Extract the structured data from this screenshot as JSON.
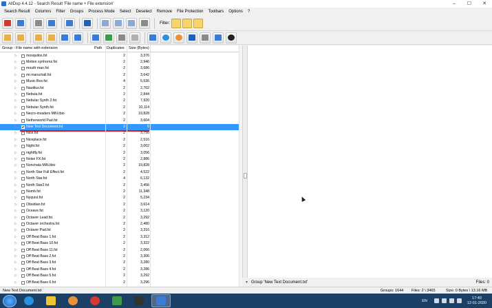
{
  "window": {
    "title": "AllDup 4.4.12 - Search Result 'File name + File extension'",
    "minimize": "–",
    "maximize": "☐",
    "close": "✕"
  },
  "menu": [
    "Search Result",
    "Columns",
    "Filter",
    "Groups",
    "Process Mode",
    "Select",
    "Deselect",
    "Remove",
    "File Protection",
    "Toolbars",
    "Options",
    "?"
  ],
  "toolbar": {
    "filter_label": "Filter:",
    "colors": {
      "orange": "#e8903a",
      "blue": "#3a7bd5",
      "green": "#3c9a4a",
      "red": "#d23a2f",
      "grey": "#8a8a8a",
      "yellow": "#f1c232"
    }
  },
  "columns": {
    "group": "Group - File name with extension",
    "path": "Path",
    "duplicates": "Duplicates",
    "size": "Size (Bytes)"
  },
  "rows": [
    {
      "name": "mosquitos.fst",
      "dup": "2",
      "size": "3,376"
    },
    {
      "name": "Motion synhornz.fst",
      "dup": "2",
      "size": "2,946"
    },
    {
      "name": "mouth man.fst",
      "dup": "2",
      "size": "3,686"
    },
    {
      "name": "mr.marschall.fst",
      "dup": "2",
      "size": "3,642"
    },
    {
      "name": "Music Box.fst",
      "dup": "4",
      "size": "5,536"
    },
    {
      "name": "Nautilus.fst",
      "dup": "2",
      "size": "2,702"
    },
    {
      "name": "Nebula.fst",
      "dup": "2",
      "size": "2,844"
    },
    {
      "name": "Nebular Synth 2.fst",
      "dup": "2",
      "size": "7,920"
    },
    {
      "name": "Nebular Synth.fst",
      "dup": "2",
      "size": "10,114"
    },
    {
      "name": "Necro-invaders MiN.tbio",
      "dup": "2",
      "size": "19,828"
    },
    {
      "name": "Netherworld Pad.fst",
      "dup": "2",
      "size": "3,604"
    },
    {
      "name": "New Text Document.txt",
      "dup": "2",
      "size": "0",
      "selected": true,
      "checked": true
    },
    {
      "name": "Nice.fst",
      "dup": "2",
      "size": "3,756"
    },
    {
      "name": "Niceplace.fst",
      "dup": "2",
      "size": "2,516"
    },
    {
      "name": "Night.fst",
      "dup": "2",
      "size": "3,002"
    },
    {
      "name": "nightfly.fst",
      "dup": "2",
      "size": "3,056"
    },
    {
      "name": "Noise FX.fst",
      "dup": "2",
      "size": "2,886"
    },
    {
      "name": "Nonchala MiN.tbio",
      "dup": "2",
      "size": "19,828"
    },
    {
      "name": "North Star Full Effect.fst",
      "dup": "2",
      "size": "4,522"
    },
    {
      "name": "North Star.fst",
      "dup": "4",
      "size": "6,132"
    },
    {
      "name": "North Star2.fst",
      "dup": "2",
      "size": "3,456"
    },
    {
      "name": "Numb.fst",
      "dup": "2",
      "size": "11,348"
    },
    {
      "name": "Nyquist.fst",
      "dup": "2",
      "size": "5,234"
    },
    {
      "name": "Obsidian.fst",
      "dup": "2",
      "size": "3,614"
    },
    {
      "name": "Oceave.fst",
      "dup": "2",
      "size": "3,120"
    },
    {
      "name": "Octaver Lead.fst",
      "dup": "2",
      "size": "3,292"
    },
    {
      "name": "Octaver orchestra.fst",
      "dup": "2",
      "size": "2,480"
    },
    {
      "name": "Octaver Pad.fst",
      "dup": "2",
      "size": "3,316"
    },
    {
      "name": "Off Beat Bass 1.fst",
      "dup": "2",
      "size": "3,312"
    },
    {
      "name": "Off Beat Bass 10.fst",
      "dup": "2",
      "size": "3,322"
    },
    {
      "name": "Off Beat Bass 11.fst",
      "dup": "2",
      "size": "2,066"
    },
    {
      "name": "Off Beat Bass 2.fst",
      "dup": "2",
      "size": "3,306"
    },
    {
      "name": "Off Beat Bass 3.fst",
      "dup": "2",
      "size": "3,280"
    },
    {
      "name": "Off Beat Bass 4.fst",
      "dup": "2",
      "size": "3,286"
    },
    {
      "name": "Off Beat Bass 5.fst",
      "dup": "2",
      "size": "3,292"
    },
    {
      "name": "Off Beat Bass 6.fst",
      "dup": "2",
      "size": "3,296"
    }
  ],
  "right_status": {
    "group_text": "Group 'New Text Document.txt'",
    "files": "Files: 0"
  },
  "statusbar": {
    "left": "New Text Document.txt",
    "groups": "Groups: 1644",
    "files": "Files: 2 \\ 3465",
    "size": "Size: 0 Bytes \\ 13.16 MB"
  },
  "taskbar": {
    "lang": "EN",
    "time": "17:40",
    "date": "12-01-2020"
  }
}
